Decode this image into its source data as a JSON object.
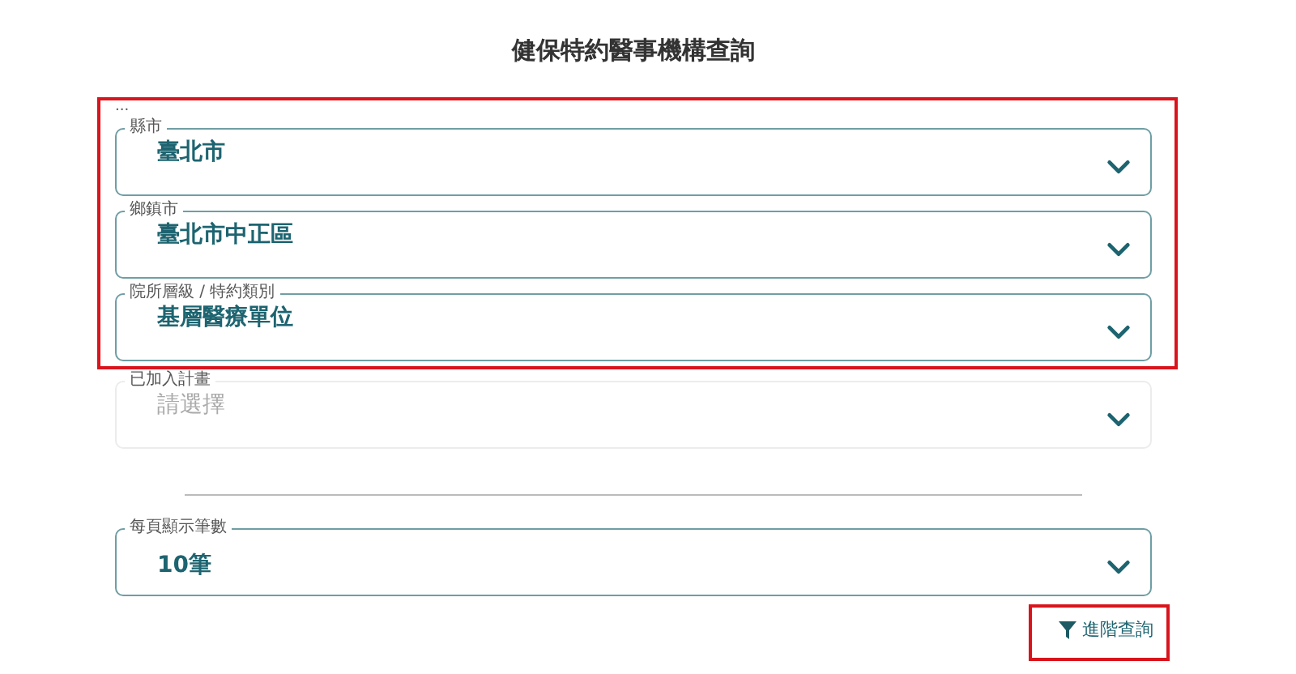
{
  "title": "健保特約醫事機構查詢",
  "select_groups": [
    {
      "highlighted": true,
      "note": "...",
      "selects": [
        {
          "label": "縣市",
          "value": "臺北市"
        },
        {
          "label": "鄉鎮市",
          "value": "臺北市中正區"
        },
        {
          "label": "院所層級 / 特約類別",
          "value": "基層醫療單位"
        }
      ]
    },
    {
      "highlighted": false,
      "selects": [
        {
          "label": "已加入計畫",
          "placeholder": "請選擇"
        }
      ]
    }
  ],
  "page_size_select": {
    "label": "每頁顯示筆數",
    "value": "10筆"
  },
  "advanced_button": {
    "label": "進階查詢",
    "highlighted": true
  }
}
